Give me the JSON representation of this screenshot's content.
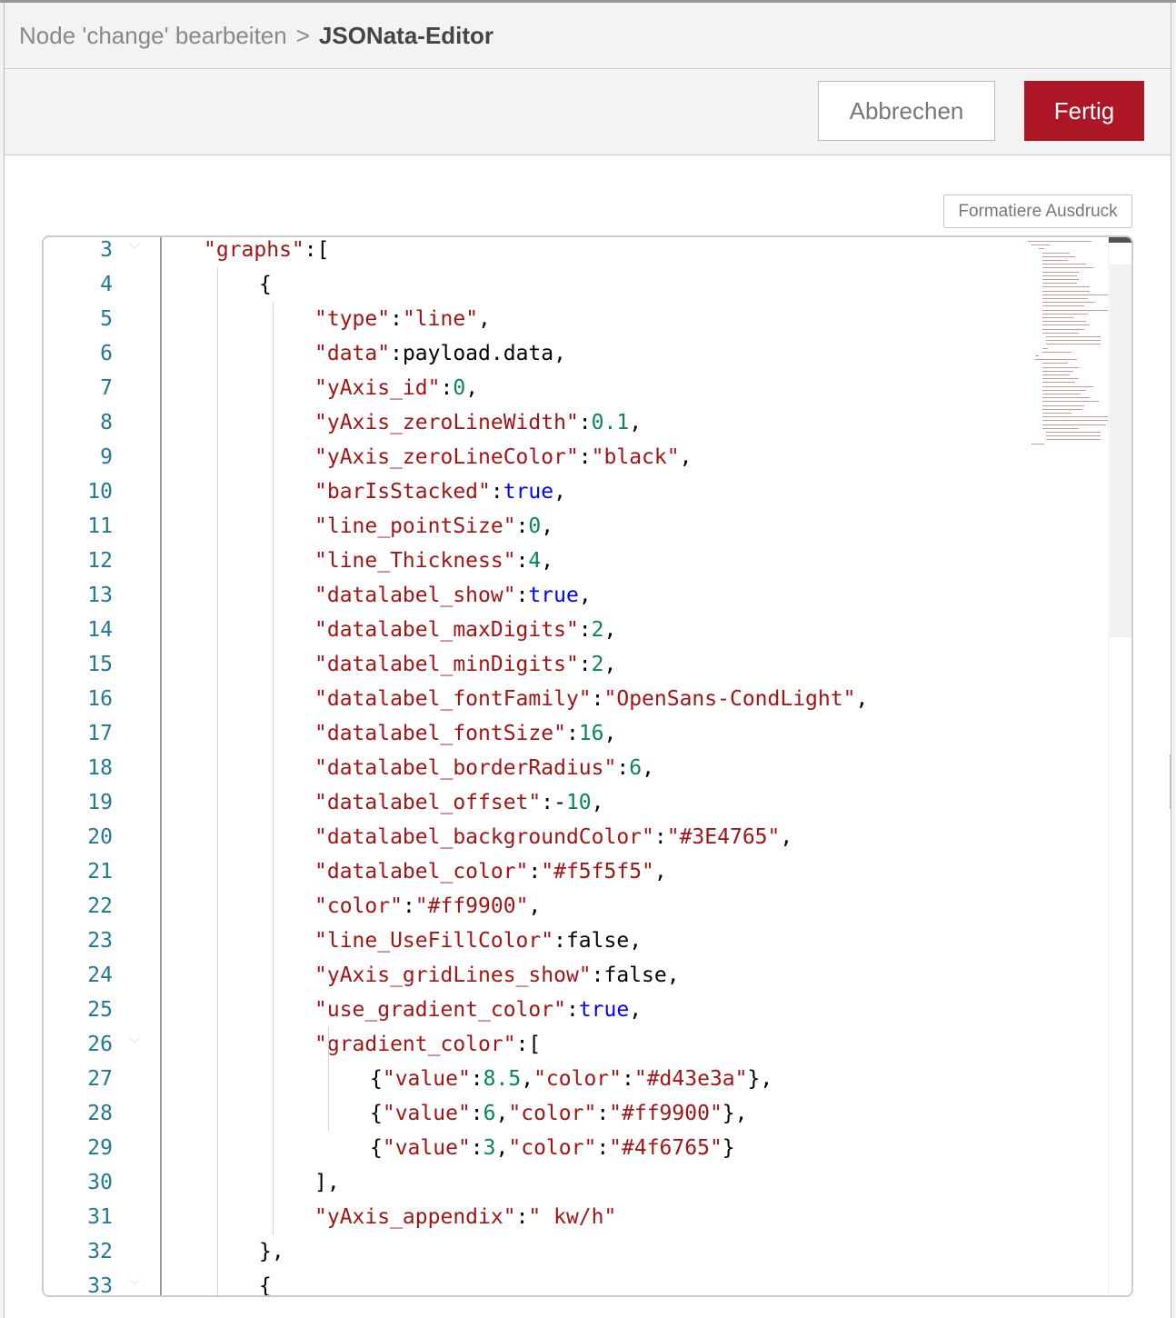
{
  "breadcrumb": {
    "parent": "Node 'change' bearbeiten",
    "separator": ">",
    "current": "JSONata-Editor"
  },
  "toolbar": {
    "cancel_label": "Abbrechen",
    "done_label": "Fertig"
  },
  "editor": {
    "format_button_label": "Formatiere Ausdruck",
    "lines": [
      {
        "num": "3",
        "indent": 0,
        "fold": true,
        "tokens": [
          [
            "k",
            "\"graphs\""
          ],
          [
            "p",
            ":["
          ]
        ]
      },
      {
        "num": "4",
        "indent": 1,
        "fold": false,
        "tokens": [
          [
            "p",
            "{"
          ]
        ]
      },
      {
        "num": "5",
        "indent": 2,
        "fold": false,
        "tokens": [
          [
            "k",
            "\"type\""
          ],
          [
            "p",
            ":"
          ],
          [
            "s",
            "\"line\""
          ],
          [
            "p",
            ","
          ]
        ]
      },
      {
        "num": "6",
        "indent": 2,
        "fold": false,
        "tokens": [
          [
            "k",
            "\"data\""
          ],
          [
            "p",
            ":payload.data,"
          ]
        ]
      },
      {
        "num": "7",
        "indent": 2,
        "fold": false,
        "tokens": [
          [
            "k",
            "\"yAxis_id\""
          ],
          [
            "p",
            ":"
          ],
          [
            "n",
            "0"
          ],
          [
            "p",
            ","
          ]
        ]
      },
      {
        "num": "8",
        "indent": 2,
        "fold": false,
        "tokens": [
          [
            "k",
            "\"yAxis_zeroLineWidth\""
          ],
          [
            "p",
            ":"
          ],
          [
            "n",
            "0.1"
          ],
          [
            "p",
            ","
          ]
        ]
      },
      {
        "num": "9",
        "indent": 2,
        "fold": false,
        "tokens": [
          [
            "k",
            "\"yAxis_zeroLineColor\""
          ],
          [
            "p",
            ":"
          ],
          [
            "s",
            "\"black\""
          ],
          [
            "p",
            ","
          ]
        ]
      },
      {
        "num": "10",
        "indent": 2,
        "fold": false,
        "tokens": [
          [
            "k",
            "\"barIsStacked\""
          ],
          [
            "p",
            ":"
          ],
          [
            "b",
            "true"
          ],
          [
            "p",
            ","
          ]
        ]
      },
      {
        "num": "11",
        "indent": 2,
        "fold": false,
        "tokens": [
          [
            "k",
            "\"line_pointSize\""
          ],
          [
            "p",
            ":"
          ],
          [
            "n",
            "0"
          ],
          [
            "p",
            ","
          ]
        ]
      },
      {
        "num": "12",
        "indent": 2,
        "fold": false,
        "tokens": [
          [
            "k",
            "\"line_Thickness\""
          ],
          [
            "p",
            ":"
          ],
          [
            "n",
            "4"
          ],
          [
            "p",
            ","
          ]
        ]
      },
      {
        "num": "13",
        "indent": 2,
        "fold": false,
        "tokens": [
          [
            "k",
            "\"datalabel_show\""
          ],
          [
            "p",
            ":"
          ],
          [
            "b",
            "true"
          ],
          [
            "p",
            ","
          ]
        ]
      },
      {
        "num": "14",
        "indent": 2,
        "fold": false,
        "tokens": [
          [
            "k",
            "\"datalabel_maxDigits\""
          ],
          [
            "p",
            ":"
          ],
          [
            "n",
            "2"
          ],
          [
            "p",
            ","
          ]
        ]
      },
      {
        "num": "15",
        "indent": 2,
        "fold": false,
        "tokens": [
          [
            "k",
            "\"datalabel_minDigits\""
          ],
          [
            "p",
            ":"
          ],
          [
            "n",
            "2"
          ],
          [
            "p",
            ","
          ]
        ]
      },
      {
        "num": "16",
        "indent": 2,
        "fold": false,
        "tokens": [
          [
            "k",
            "\"datalabel_fontFamily\""
          ],
          [
            "p",
            ":"
          ],
          [
            "s",
            "\"OpenSans-CondLight\""
          ],
          [
            "p",
            ","
          ]
        ]
      },
      {
        "num": "17",
        "indent": 2,
        "fold": false,
        "tokens": [
          [
            "k",
            "\"datalabel_fontSize\""
          ],
          [
            "p",
            ":"
          ],
          [
            "n",
            "16"
          ],
          [
            "p",
            ","
          ]
        ]
      },
      {
        "num": "18",
        "indent": 2,
        "fold": false,
        "tokens": [
          [
            "k",
            "\"datalabel_borderRadius\""
          ],
          [
            "p",
            ":"
          ],
          [
            "n",
            "6"
          ],
          [
            "p",
            ","
          ]
        ]
      },
      {
        "num": "19",
        "indent": 2,
        "fold": false,
        "tokens": [
          [
            "k",
            "\"datalabel_offset\""
          ],
          [
            "p",
            ":-"
          ],
          [
            "n",
            "10"
          ],
          [
            "p",
            ","
          ]
        ]
      },
      {
        "num": "20",
        "indent": 2,
        "fold": false,
        "tokens": [
          [
            "k",
            "\"datalabel_backgroundColor\""
          ],
          [
            "p",
            ":"
          ],
          [
            "s",
            "\"#3E4765\""
          ],
          [
            "p",
            ","
          ]
        ]
      },
      {
        "num": "21",
        "indent": 2,
        "fold": false,
        "tokens": [
          [
            "k",
            "\"datalabel_color\""
          ],
          [
            "p",
            ":"
          ],
          [
            "s",
            "\"#f5f5f5\""
          ],
          [
            "p",
            ","
          ]
        ]
      },
      {
        "num": "22",
        "indent": 2,
        "fold": false,
        "tokens": [
          [
            "k",
            "\"color\""
          ],
          [
            "p",
            ":"
          ],
          [
            "s",
            "\"#ff9900\""
          ],
          [
            "p",
            ","
          ]
        ]
      },
      {
        "num": "23",
        "indent": 2,
        "fold": false,
        "tokens": [
          [
            "k",
            "\"line_UseFillColor\""
          ],
          [
            "p",
            ":false,"
          ]
        ]
      },
      {
        "num": "24",
        "indent": 2,
        "fold": false,
        "tokens": [
          [
            "k",
            "\"yAxis_gridLines_show\""
          ],
          [
            "p",
            ":false,"
          ]
        ]
      },
      {
        "num": "25",
        "indent": 2,
        "fold": false,
        "tokens": [
          [
            "k",
            "\"use_gradient_color\""
          ],
          [
            "p",
            ":"
          ],
          [
            "b",
            "true"
          ],
          [
            "p",
            ","
          ]
        ]
      },
      {
        "num": "26",
        "indent": 2,
        "fold": true,
        "tokens": [
          [
            "k",
            "\"gradient_color\""
          ],
          [
            "p",
            ":["
          ]
        ]
      },
      {
        "num": "27",
        "indent": 3,
        "fold": false,
        "tokens": [
          [
            "p",
            "{"
          ],
          [
            "k",
            "\"value\""
          ],
          [
            "p",
            ":"
          ],
          [
            "n",
            "8.5"
          ],
          [
            "p",
            ","
          ],
          [
            "k",
            "\"color\""
          ],
          [
            "p",
            ":"
          ],
          [
            "s",
            "\"#d43e3a\""
          ],
          [
            "p",
            "},"
          ]
        ]
      },
      {
        "num": "28",
        "indent": 3,
        "fold": false,
        "tokens": [
          [
            "p",
            "{"
          ],
          [
            "k",
            "\"value\""
          ],
          [
            "p",
            ":"
          ],
          [
            "n",
            "6"
          ],
          [
            "p",
            ","
          ],
          [
            "k",
            "\"color\""
          ],
          [
            "p",
            ":"
          ],
          [
            "s",
            "\"#ff9900\""
          ],
          [
            "p",
            "},"
          ]
        ]
      },
      {
        "num": "29",
        "indent": 3,
        "fold": false,
        "tokens": [
          [
            "p",
            "{"
          ],
          [
            "k",
            "\"value\""
          ],
          [
            "p",
            ":"
          ],
          [
            "n",
            "3"
          ],
          [
            "p",
            ","
          ],
          [
            "k",
            "\"color\""
          ],
          [
            "p",
            ":"
          ],
          [
            "s",
            "\"#4f6765\""
          ],
          [
            "p",
            "}"
          ]
        ]
      },
      {
        "num": "30",
        "indent": 2,
        "fold": false,
        "tokens": [
          [
            "p",
            "],"
          ]
        ]
      },
      {
        "num": "31",
        "indent": 2,
        "fold": false,
        "tokens": [
          [
            "k",
            "\"yAxis_appendix\""
          ],
          [
            "p",
            ":"
          ],
          [
            "s",
            "\" kw/h\""
          ]
        ]
      },
      {
        "num": "32",
        "indent": 1,
        "fold": false,
        "tokens": [
          [
            "p",
            "},"
          ]
        ]
      },
      {
        "num": "33",
        "indent": 1,
        "fold": true,
        "tokens": [
          [
            "p",
            "{"
          ]
        ]
      }
    ]
  }
}
